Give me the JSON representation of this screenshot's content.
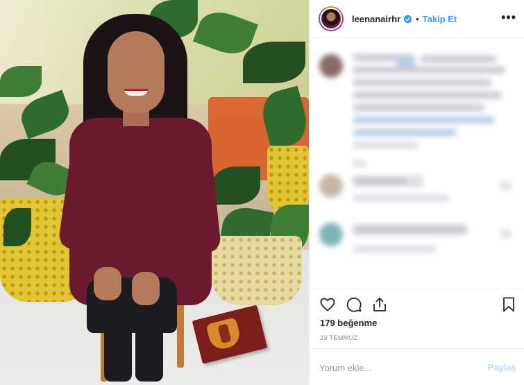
{
  "post": {
    "username": "leenanairhr",
    "separator": "•",
    "follow_label": "Takip Et",
    "more_label": "•••",
    "likes": "179 beğenme",
    "date": "23 TEMMUZ",
    "comment_placeholder": "Yorum ekle...",
    "share_label": "Paylaş"
  },
  "icons": {
    "verified": "verified-badge-icon",
    "like": "heart-icon",
    "comment": "comment-icon",
    "share": "share-icon",
    "save": "bookmark-icon",
    "more": "more-options-icon"
  },
  "colors": {
    "accent": "#3897f0",
    "text": "#262626",
    "muted": "#8e8e8e",
    "disabled_button": "#b3dbff",
    "dress": "#6b1a2e",
    "pot_yellow": "#e2c532"
  }
}
